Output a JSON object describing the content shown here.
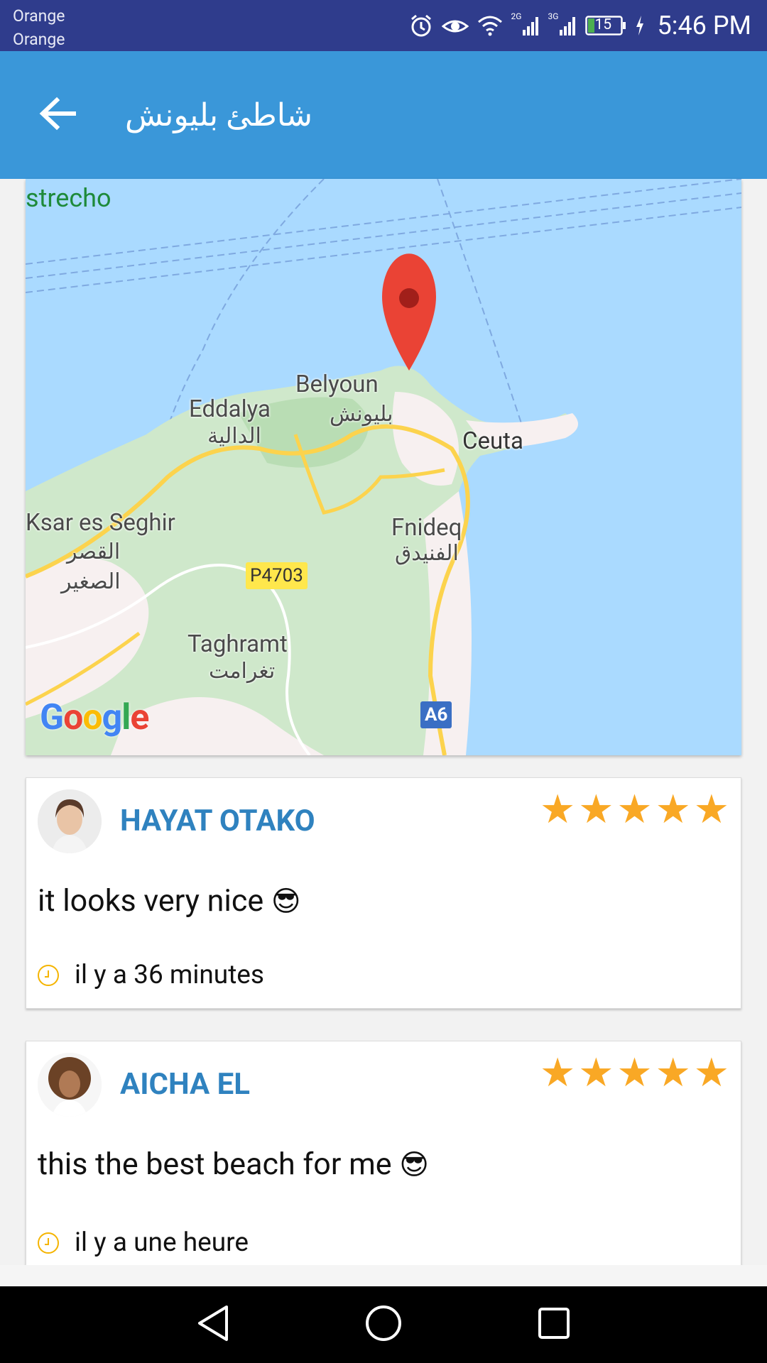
{
  "status_bar": {
    "carrier_1": "Orange",
    "carrier_2": "Orange",
    "network_1": "2G",
    "network_2": "3G",
    "battery": "15",
    "time": "5:46 PM"
  },
  "app_bar": {
    "title": "شاطئ بليونش",
    "back_icon": "arrow-back-icon",
    "color": "#3a97d9"
  },
  "map": {
    "labels": {
      "strait": "strecho",
      "belyounech": "Belyoun",
      "belyounech_ar": "بليونش",
      "eddalya": "Eddalya",
      "eddalya_ar": "الدالية",
      "ceuta": "Ceuta",
      "ksar": "Ksar es Seghir",
      "ksar_ar_1": "القصر",
      "ksar_ar_2": "الصغير",
      "fnideq": "Fnideq",
      "fnideq_ar": "الفنيدق",
      "taghramt": "Taghramt",
      "taghramt_ar": "تغرامت",
      "road_p4703": "P4703",
      "road_a6": "A6"
    },
    "attribution": "Google",
    "marker_icon": "map-pin-icon"
  },
  "reviews": [
    {
      "name": "HAYAT OTAKO",
      "rating": 5,
      "comment": "it looks very nice",
      "emoji": "😎",
      "time": "il y a 36 minutes"
    },
    {
      "name": "AICHA EL",
      "rating": 5,
      "comment": "this the best beach for me",
      "emoji": "😎",
      "time": "il y a une heure"
    }
  ],
  "nav_bar": {
    "back": "nav-back-icon",
    "home": "nav-home-icon",
    "recents": "nav-recents-icon"
  }
}
